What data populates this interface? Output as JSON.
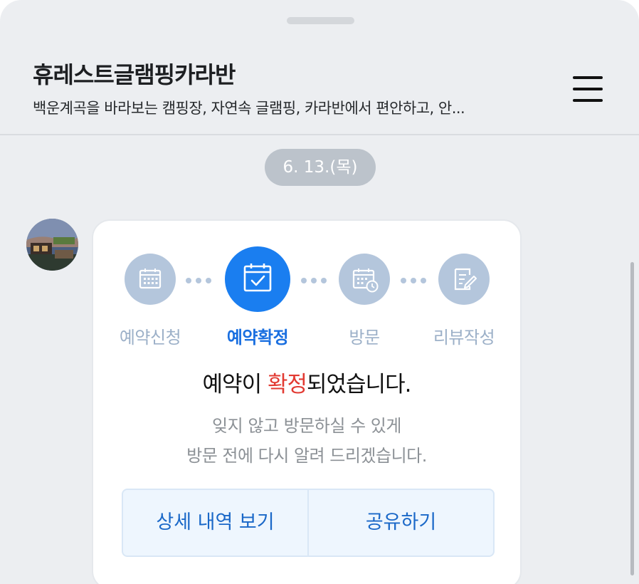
{
  "header": {
    "title": "휴레스트글램핑카라반",
    "subtitle": "백운계곡을 바라보는 캠핑장, 자연속 글램핑, 카라반에서 편안하고, 안..."
  },
  "chat": {
    "date": "6. 13.(목)"
  },
  "reservation": {
    "steps": [
      {
        "label": "예약신청",
        "icon": "calendar-icon"
      },
      {
        "label": "예약확정",
        "icon": "calendar-check-icon",
        "active": true
      },
      {
        "label": "방문",
        "icon": "calendar-clock-icon"
      },
      {
        "label": "리뷰작성",
        "icon": "review-edit-icon"
      }
    ],
    "headline_before": "예약이 ",
    "headline_accent": "확정",
    "headline_after": "되었습니다.",
    "description_line1": "잊지 않고 방문하실 수 있게",
    "description_line2": "방문 전에 다시 알려 드리겠습니다.",
    "detail_button": "상세 내역 보기",
    "share_button": "공유하기"
  },
  "colors": {
    "active_step": "#1a7ef0",
    "inactive_step": "#b4c6dc",
    "accent_red": "#e23a32",
    "button_text": "#1a68c8"
  }
}
